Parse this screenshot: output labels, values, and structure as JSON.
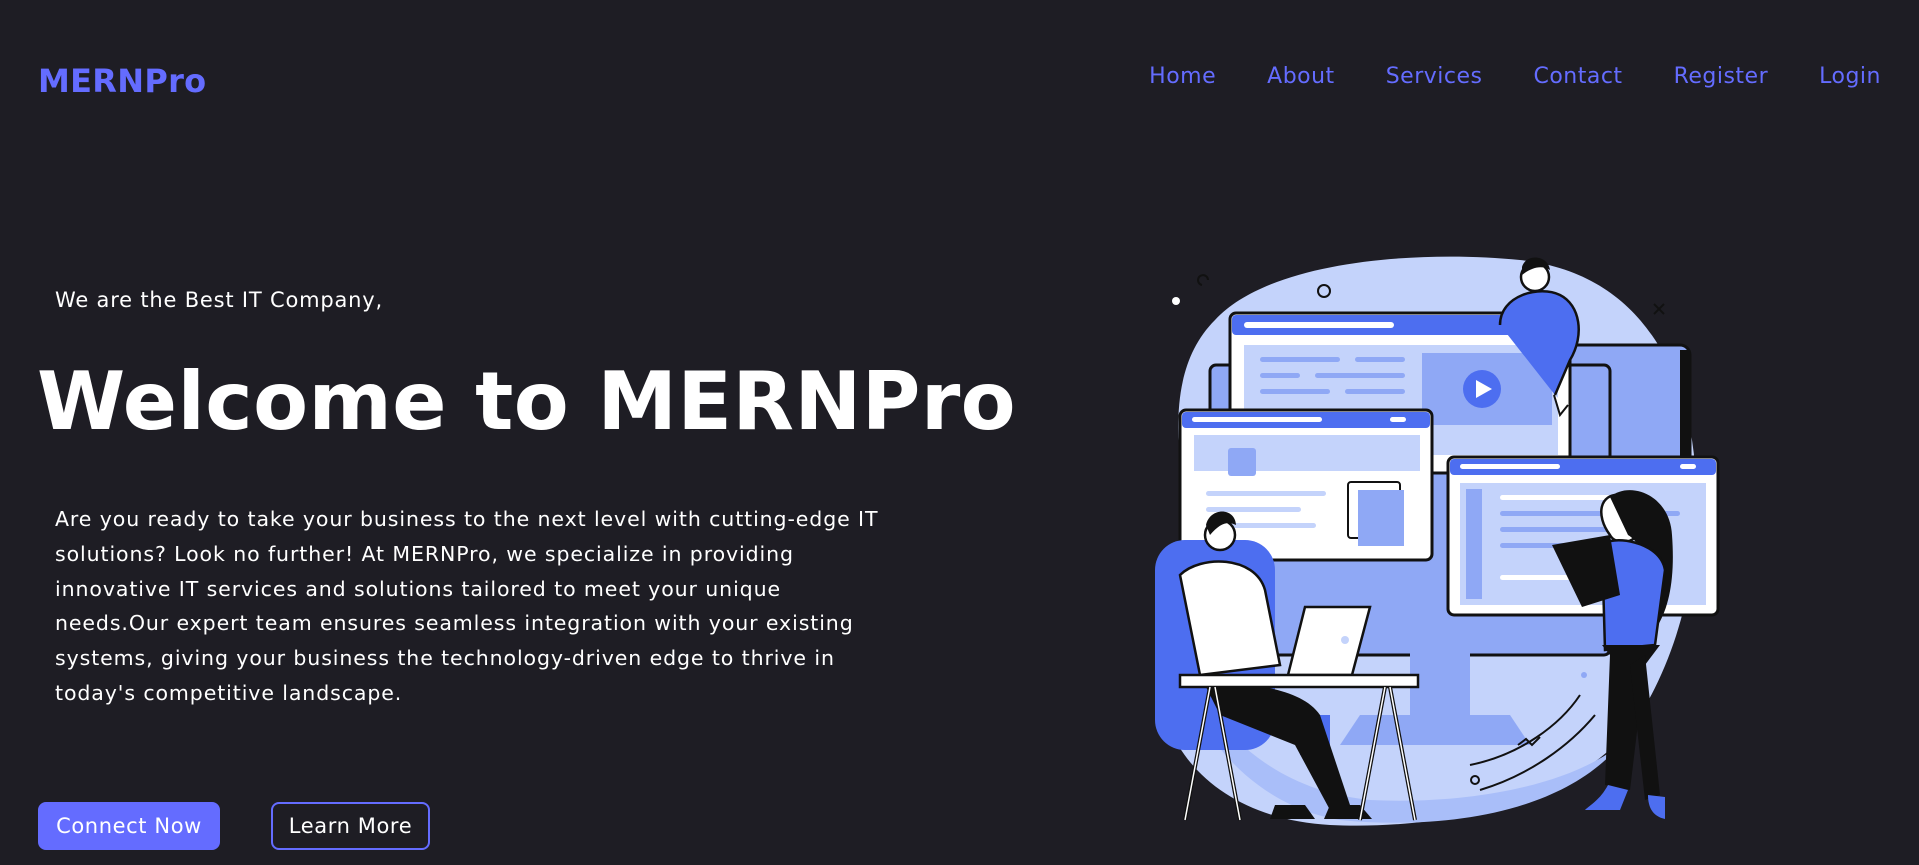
{
  "header": {
    "logo": "MERNPro",
    "nav": [
      {
        "label": "Home"
      },
      {
        "label": "About"
      },
      {
        "label": "Services"
      },
      {
        "label": "Contact"
      },
      {
        "label": "Register"
      },
      {
        "label": "Login"
      }
    ]
  },
  "hero": {
    "intro": "We are the Best IT Company,",
    "title": "Welcome to MERNPro",
    "description": "Are you ready to take your business to the next level with cutting-edge IT solutions? Look no further! At MERNPro, we specialize in providing innovative IT services and solutions tailored to meet your unique needs.Our expert team ensures seamless integration with your existing systems, giving your business the technology-driven edge to thrive in today's competitive landscape.",
    "primary_button": "Connect Now",
    "secondary_button": "Learn More"
  },
  "colors": {
    "background": "#1e1d24",
    "accent": "#646cff",
    "text": "#ffffff",
    "illustration_light": "#c4d3fb",
    "illustration_mid": "#8fa8f5",
    "illustration_dark": "#4d6ef0"
  },
  "icons": {
    "illustration": "team-working-with-computers-illustration",
    "play": "play-icon"
  }
}
